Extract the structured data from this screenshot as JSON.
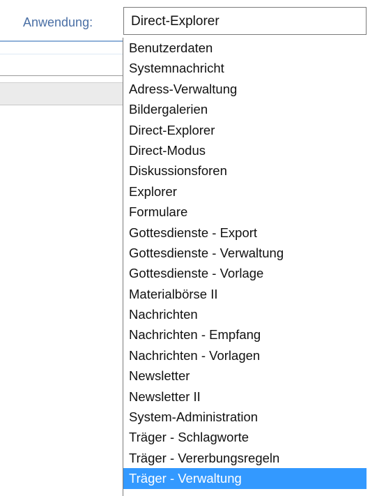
{
  "field_label": "Anwendung:",
  "select": {
    "value": "Direct-Explorer"
  },
  "options": [
    "Benutzerdaten",
    "Systemnachricht",
    "Adress-Verwaltung",
    "Bildergalerien",
    "Direct-Explorer",
    "Direct-Modus",
    "Diskussionsforen",
    "Explorer",
    "Formulare",
    "Gottesdienste - Export",
    "Gottesdienste - Verwaltung",
    "Gottesdienste - Vorlage",
    "Materialbörse II",
    "Nachrichten",
    "Nachrichten - Empfang",
    "Nachrichten - Vorlagen",
    "Newsletter",
    "Newsletter II",
    "System-Administration",
    "Träger - Schlagworte",
    "Träger - Vererbungsregeln",
    "Träger - Verwaltung"
  ],
  "highlighted_option": "Träger - Verwaltung",
  "colors": {
    "label": "#4a6fa5",
    "highlight": "#3399ff"
  }
}
